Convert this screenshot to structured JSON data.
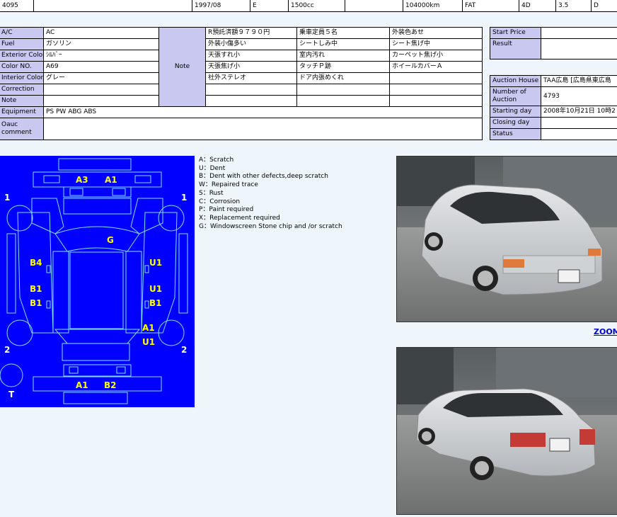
{
  "top_row": [
    "4095",
    "",
    "1997/08",
    "E",
    "1500cc",
    "",
    "104000km",
    "FAT",
    "4D",
    "3.5",
    "D"
  ],
  "specs": {
    "ac_label": "A/C",
    "ac_value": "AC",
    "fuel_label": "Fuel",
    "fuel_value": "ガソリン",
    "ext_color_label": "Exterior Color",
    "ext_color_value": "ｼﾙﾊﾞｰ",
    "color_no_label": "Color NO.",
    "color_no_value": "A69",
    "int_color_label": "Interior Color",
    "int_color_value": "グレー",
    "correction_label": "Correction",
    "correction_value": "",
    "note_label": "Note",
    "note_value": "",
    "equipment_label": "Equipment",
    "equipment_value": "PS PW ABG ABS",
    "oauc_label": "Oauc comment",
    "oauc_value": ""
  },
  "note_block": {
    "label": "Note",
    "rows": [
      [
        "R預託済額９７９０円",
        "乗車定員５名",
        "外装色あせ"
      ],
      [
        "外装小傷多い",
        "シートしみ中",
        "シート焦げ中"
      ],
      [
        "天張すれ小",
        "室内汚れ",
        "カーペット焦げ小"
      ],
      [
        "天張焦げ小",
        "タッチＰ跡",
        "ホイールカバーＡ"
      ],
      [
        "社外ステレオ",
        "ドア内張めくれ",
        ""
      ],
      [
        "",
        "",
        ""
      ],
      [
        "",
        "",
        ""
      ]
    ]
  },
  "price": {
    "start_label": "Start Price",
    "start_value": "",
    "result_label": "Result",
    "result_value": ""
  },
  "auction": {
    "house_label": "Auction House",
    "house_value": "TAA広島 [広島県東広島",
    "number_label": "Number of Auction",
    "number_value": "4793",
    "start_label": "Starting day",
    "start_value": "2008年10月21日 10時2",
    "closing_label": "Closing day",
    "closing_value": "",
    "status_label": "Status",
    "status_value": ""
  },
  "legend": [
    "A：Scratch",
    "U：Dent",
    "B：Dent with other defects,deep scratch",
    "W：Repaired trace",
    "S：Rust",
    "C：Corrosion",
    "P：Paint required",
    "X：Replacement required",
    "G：Windowscreen Stone chip and /or scratch"
  ],
  "diagram": {
    "marks": [
      "A3",
      "A1",
      "G",
      "B4",
      "U1",
      "B1",
      "U1",
      "B1",
      "B1",
      "A1",
      "U1",
      "A1",
      "B2"
    ],
    "wheel_left_front": "1",
    "wheel_right_front": "1",
    "wheel_left_rear": "2",
    "wheel_right_rear": "2",
    "trunk": "T"
  },
  "zoom_label": "ZOOM",
  "colors": {
    "diagram_bg": "#0000ff",
    "label_bg": "#c8c8f0",
    "page_bg": "#eef6fb",
    "mark": "#ffff00"
  }
}
